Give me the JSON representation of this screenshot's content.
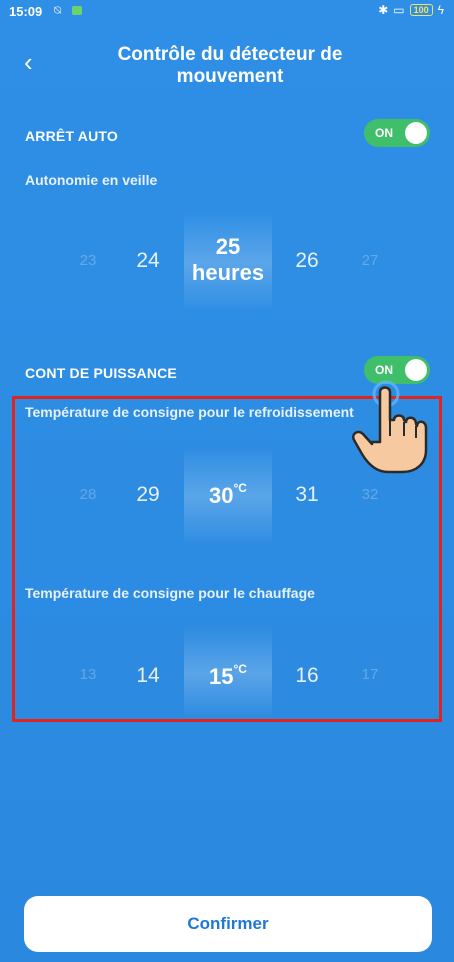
{
  "status": {
    "time": "15:09",
    "battery": "100",
    "colors": {
      "battery": "#f4e25a",
      "notification": "#6ad36a"
    }
  },
  "header": {
    "title_line1": "Contrôle du détecteur de",
    "title_line2": "mouvement"
  },
  "auto_off": {
    "label": "ARRÊT AUTO",
    "toggle": "ON",
    "sublabel": "Autonomie en veille",
    "values": [
      "23",
      "24",
      "25",
      "26",
      "27"
    ],
    "selected_unit": "heures"
  },
  "power_control": {
    "label": "CONT DE PUISSANCE",
    "toggle": "ON",
    "cooling": {
      "label": "Température de consigne pour le refroidissement",
      "values": [
        "28",
        "29",
        "30",
        "31",
        "32"
      ],
      "unit": "°C"
    },
    "heating": {
      "label": "Température de consigne pour le chauffage",
      "values": [
        "13",
        "14",
        "15",
        "16",
        "17"
      ],
      "unit": "°C"
    }
  },
  "confirm": {
    "label": "Confirmer"
  },
  "colors": {
    "background": "#2d8de3",
    "toggle_on": "#3fbf6a",
    "highlight_box": "#e0241e",
    "confirm_text": "#1e78d6"
  }
}
